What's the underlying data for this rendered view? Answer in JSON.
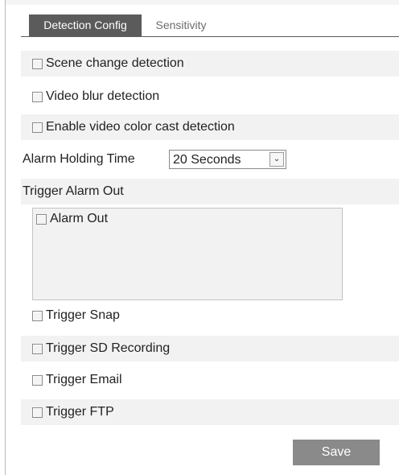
{
  "tabs": {
    "detection_config": "Detection Config",
    "sensitivity": "Sensitivity"
  },
  "detection": {
    "scene_change": {
      "label": "Scene change detection",
      "checked": false
    },
    "video_blur": {
      "label": "Video blur detection",
      "checked": false
    },
    "color_cast": {
      "label": "Enable video color cast detection",
      "checked": false
    }
  },
  "alarm_holding": {
    "label": "Alarm Holding Time",
    "value": "20 Seconds",
    "dropdown_icon": "chevron-down-icon"
  },
  "trigger_alarm_out": {
    "title": "Trigger Alarm Out",
    "items": [
      {
        "label": "Alarm Out",
        "checked": false
      }
    ]
  },
  "triggers": {
    "snap": {
      "label": "Trigger Snap",
      "checked": false
    },
    "sd_recording": {
      "label": "Trigger SD Recording",
      "checked": false
    },
    "email": {
      "label": "Trigger Email",
      "checked": false
    },
    "ftp": {
      "label": "Trigger FTP",
      "checked": false
    }
  },
  "actions": {
    "save_label": "Save"
  },
  "colors": {
    "active_tab_bg": "#5b5b5b",
    "row_shade": "#f2f2f2",
    "save_button_bg": "#8a8a8a"
  }
}
